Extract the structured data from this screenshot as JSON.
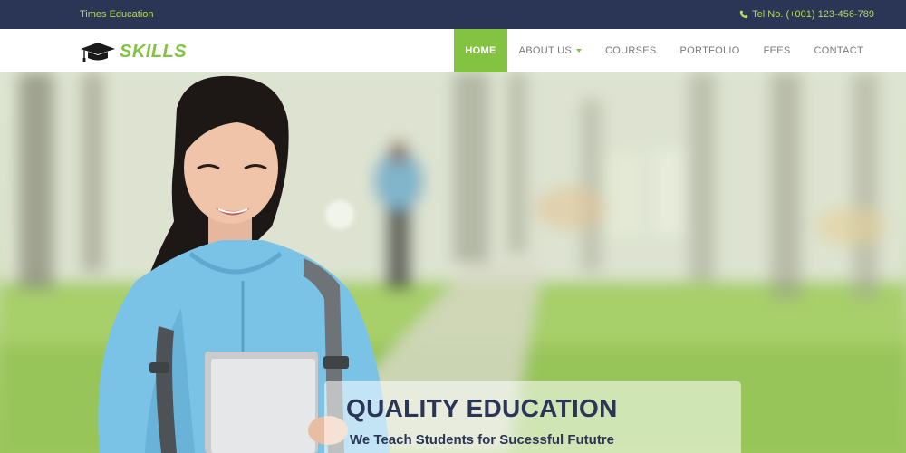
{
  "topbar": {
    "brand_text": "Times Education",
    "tel": "Tel No. (+001) 123-456-789"
  },
  "logo": {
    "text": "SKILLS",
    "icon": "graduation-cap-icon"
  },
  "nav": {
    "items": [
      {
        "label": "HOME",
        "active": true
      },
      {
        "label": "ABOUT US",
        "dropdown": true
      },
      {
        "label": "COURSES"
      },
      {
        "label": "PORTFOLIO"
      },
      {
        "label": "FEES"
      },
      {
        "label": "CONTACT"
      }
    ]
  },
  "hero": {
    "title": "QUALITY EDUCATION",
    "subtitle": "We Teach Students for Sucessful Fututre"
  },
  "colors": {
    "topbar_bg": "#2b3556",
    "accent_green": "#84c341",
    "heading_navy": "#2b3556"
  }
}
